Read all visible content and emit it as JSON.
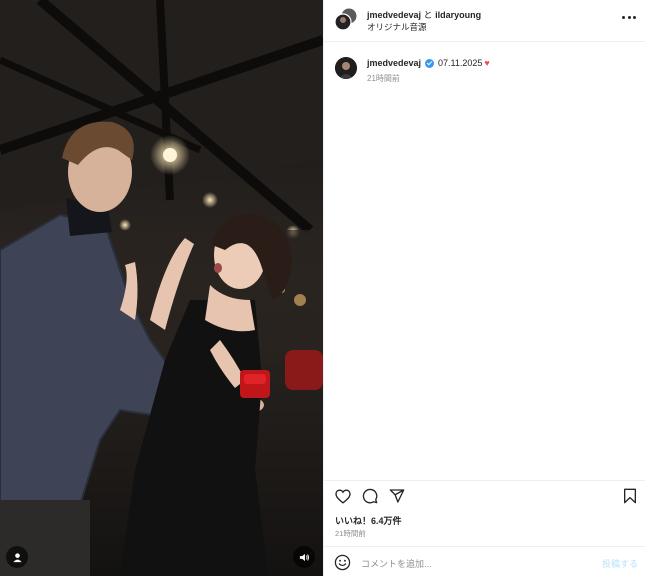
{
  "header": {
    "user1": "jmedvedevaj",
    "joiner": "と",
    "user2": "ildaryoung",
    "audio": "オリジナル音源"
  },
  "caption": {
    "username": "jmedvedevaj",
    "text": "07.11.2025",
    "heart": "♥",
    "time": "21時間前"
  },
  "actions": {
    "likes": "いいね！6.4万件",
    "time": "21時間前"
  },
  "comment": {
    "placeholder": "コメントを追加...",
    "post_label": "投稿する"
  },
  "colors": {
    "verified": "#3897f0",
    "heart": "#ed4956",
    "post_disabled": "#b2dffc"
  },
  "icons": [
    "like-icon",
    "comment-icon",
    "share-icon",
    "save-icon",
    "emoji-icon",
    "more-icon",
    "user-tag-icon",
    "mute-icon",
    "verified-icon"
  ]
}
